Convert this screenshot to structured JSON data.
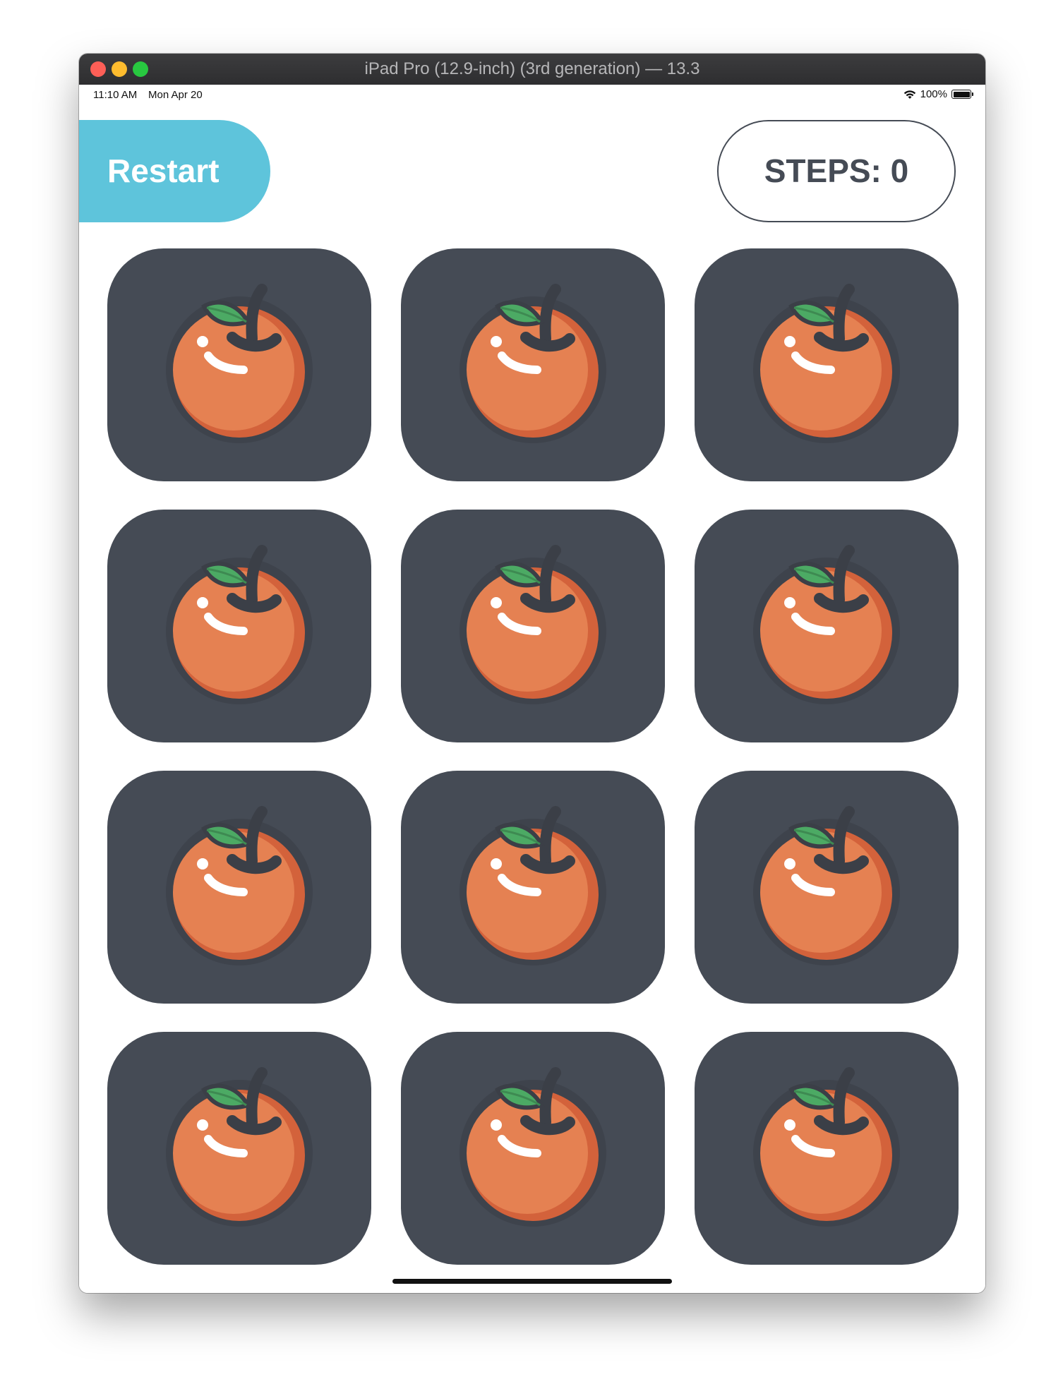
{
  "window": {
    "title": "iPad Pro (12.9-inch) (3rd generation) — 13.3"
  },
  "status_bar": {
    "time": "11:10 AM",
    "date": "Mon Apr 20",
    "battery": "100%",
    "icons": [
      "wifi-icon",
      "battery-icon"
    ]
  },
  "header": {
    "restart_label": "Restart",
    "steps_label": "STEPS: 0"
  },
  "grid": {
    "rows": 4,
    "columns": 3,
    "card_icon": "orange-icon",
    "cards": [
      {
        "icon": "orange-icon"
      },
      {
        "icon": "orange-icon"
      },
      {
        "icon": "orange-icon"
      },
      {
        "icon": "orange-icon"
      },
      {
        "icon": "orange-icon"
      },
      {
        "icon": "orange-icon"
      },
      {
        "icon": "orange-icon"
      },
      {
        "icon": "orange-icon"
      },
      {
        "icon": "orange-icon"
      },
      {
        "icon": "orange-icon"
      },
      {
        "icon": "orange-icon"
      },
      {
        "icon": "orange-icon"
      }
    ]
  },
  "colors": {
    "restart_bg": "#5ec4db",
    "card_bg": "#454b55",
    "text_dark": "#454b55",
    "orange": "#e58152",
    "orange_shade": "#d3623b",
    "leaf": "#4caa64"
  }
}
